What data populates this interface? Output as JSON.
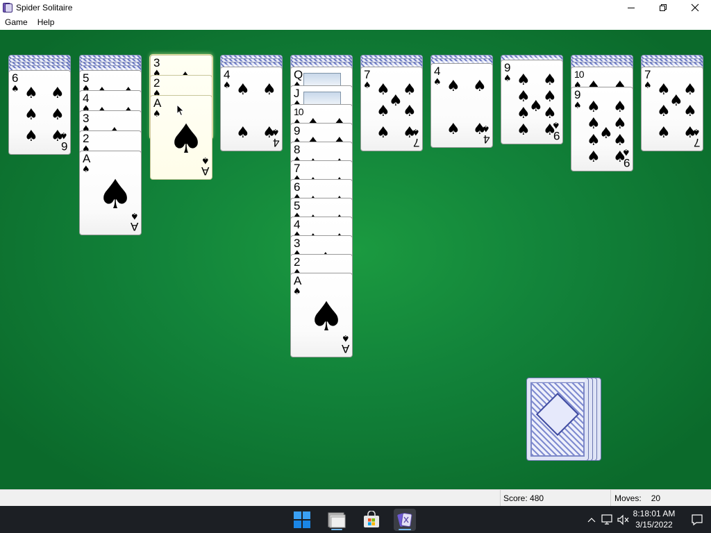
{
  "window": {
    "title": "Spider Solitaire"
  },
  "menu": {
    "items": [
      "Game",
      "Help"
    ]
  },
  "status": {
    "score_label": "Score:",
    "score_value": "480",
    "moves_label": "Moves:",
    "moves_value": "20"
  },
  "taskbar": {
    "time": "8:18:01 AM",
    "date": "3/15/2022"
  },
  "icons": {
    "app": "spider-solitaire-icon",
    "minimize": "minimize-icon",
    "maximize": "restore-icon",
    "close": "close-icon",
    "start": "windows-start-icon",
    "explorer": "file-explorer-icon",
    "store": "microsoft-store-icon",
    "solitaire": "spider-solitaire-taskbar-icon",
    "chevron": "chevron-up-icon",
    "network": "network-icon",
    "volume": "volume-muted-icon",
    "notifications": "notifications-icon"
  },
  "colors": {
    "felt": "#12833a",
    "taskbar": "#1c1f24",
    "statusbar": "#f0f0f0"
  },
  "suit": "♠",
  "tableau": [
    {
      "face_down": 4,
      "face_up": [
        "6"
      ]
    },
    {
      "face_down": 4,
      "face_up": [
        "5",
        "4",
        "3",
        "2",
        "A"
      ]
    },
    {
      "face_down": 0,
      "face_up": [
        "3",
        "2",
        "A"
      ],
      "highlighted": true
    },
    {
      "face_down": 3,
      "face_up": [
        "4"
      ]
    },
    {
      "face_down": 3,
      "face_up": [
        "Q",
        "J",
        "10",
        "9",
        "8",
        "7",
        "6",
        "5",
        "4",
        "3",
        "2",
        "A"
      ]
    },
    {
      "face_down": 3,
      "face_up": [
        "7"
      ]
    },
    {
      "face_down": 2,
      "face_up": [
        "4"
      ]
    },
    {
      "face_down": 1,
      "face_up": [
        "9"
      ]
    },
    {
      "face_down": 3,
      "face_up": [
        "10",
        "9"
      ]
    },
    {
      "face_down": 3,
      "face_up": [
        "7"
      ]
    }
  ],
  "stock": {
    "piles_remaining": 4
  }
}
